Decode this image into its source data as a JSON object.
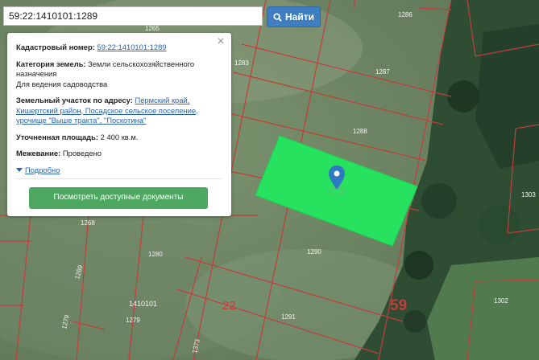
{
  "search": {
    "value": "59:22:1410101:1289",
    "button_label": "Найти"
  },
  "popup": {
    "cad_label": "Кадастровый номер:",
    "cad_value": "59:22:1410101:1289",
    "cat_label": "Категория земель:",
    "cat_value": "Земли сельскохозяйственного",
    "cat_value2": "назначения",
    "use_value": "Для ведения садоводства",
    "addr_label": "Земельный участок по адресу:",
    "addr_line1": "Пермский край,",
    "addr_line2": "Кишертский район, Посадское сельское поселение,",
    "addr_line3": "урочище \"Выше тракта\", \"Поскотина\"",
    "area_label": "Уточненная площадь:",
    "area_value": "2 400 кв.м.",
    "survey_label": "Межевание:",
    "survey_value": "Проведено",
    "details_link": "Подробно",
    "docs_button": "Посмотреть доступные документы"
  },
  "map": {
    "parcel_labels": [
      "1265",
      "1286",
      "1283",
      "1287",
      "1288",
      "1303",
      "1268",
      "1280",
      "1290",
      "1289",
      "1410101",
      "1279",
      "1302",
      "1291",
      "1373"
    ],
    "district_label": "22",
    "region_label": "59"
  },
  "colors": {
    "parcel_fill": "#27e25f",
    "boundary": "#c43c3c",
    "button_blue": "#3f7fc1",
    "button_green": "#4fa861",
    "link": "#2a63b0"
  },
  "icons": {
    "marker": "map-pin-icon",
    "search": "search-icon",
    "close": "close-icon",
    "expand": "triangle-down-icon"
  }
}
